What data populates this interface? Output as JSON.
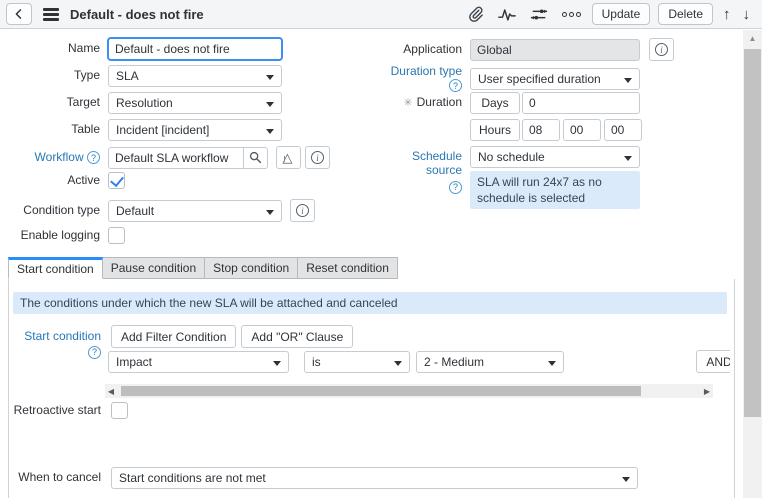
{
  "header": {
    "title": "Default - does not fire",
    "update_label": "Update",
    "delete_label": "Delete",
    "icons": [
      "back-chevron",
      "hamburger-menu",
      "paperclip",
      "activity-stream",
      "personalize-form",
      "more-options",
      "scroll-up-arrow",
      "scroll-down-arrow"
    ]
  },
  "fields": {
    "name": {
      "label": "Name",
      "value": "Default - does not fire"
    },
    "type": {
      "label": "Type",
      "value": "SLA"
    },
    "target": {
      "label": "Target",
      "value": "Resolution"
    },
    "table": {
      "label": "Table",
      "value": "Incident [incident]"
    },
    "workflow": {
      "label": "Workflow",
      "value": "Default SLA workflow"
    },
    "active": {
      "label": "Active",
      "checked": true
    },
    "condition_type": {
      "label": "Condition type",
      "value": "Default"
    },
    "enable_logging": {
      "label": "Enable logging",
      "checked": false
    },
    "application": {
      "label": "Application",
      "value": "Global",
      "readonly": true
    },
    "duration_type": {
      "label": "Duration type",
      "value": "User specified duration"
    },
    "duration": {
      "label": "Duration",
      "required": true,
      "days_label": "Days",
      "days_value": "0",
      "hours_label": "Hours",
      "hours": "08",
      "minutes": "00",
      "seconds": "00"
    },
    "schedule_source": {
      "label": "Schedule source",
      "value": "No schedule",
      "note": "SLA will run 24x7 as no schedule is selected"
    },
    "retroactive_start": {
      "label": "Retroactive start",
      "checked": false
    },
    "when_to_cancel": {
      "label": "When to cancel",
      "value": "Start conditions are not met"
    }
  },
  "tabs": [
    {
      "label": "Start condition",
      "active": true
    },
    {
      "label": "Pause condition",
      "active": false
    },
    {
      "label": "Stop condition",
      "active": false
    },
    {
      "label": "Reset condition",
      "active": false
    }
  ],
  "condition": {
    "info_banner": "The conditions under which the new SLA will be attached and canceled",
    "start_label": "Start condition",
    "add_filter_label": "Add Filter Condition",
    "add_or_label": "Add \"OR\" Clause",
    "filter": {
      "field": "Impact",
      "operator": "is",
      "value": "2 - Medium",
      "and_label": "AND"
    }
  },
  "colors": {
    "accent_blue": "#278efc",
    "link_blue": "#2977b3",
    "info_bg": "#dbeafa",
    "header_bg": "#f4f5f6",
    "check_blue": "#2f80ed"
  }
}
